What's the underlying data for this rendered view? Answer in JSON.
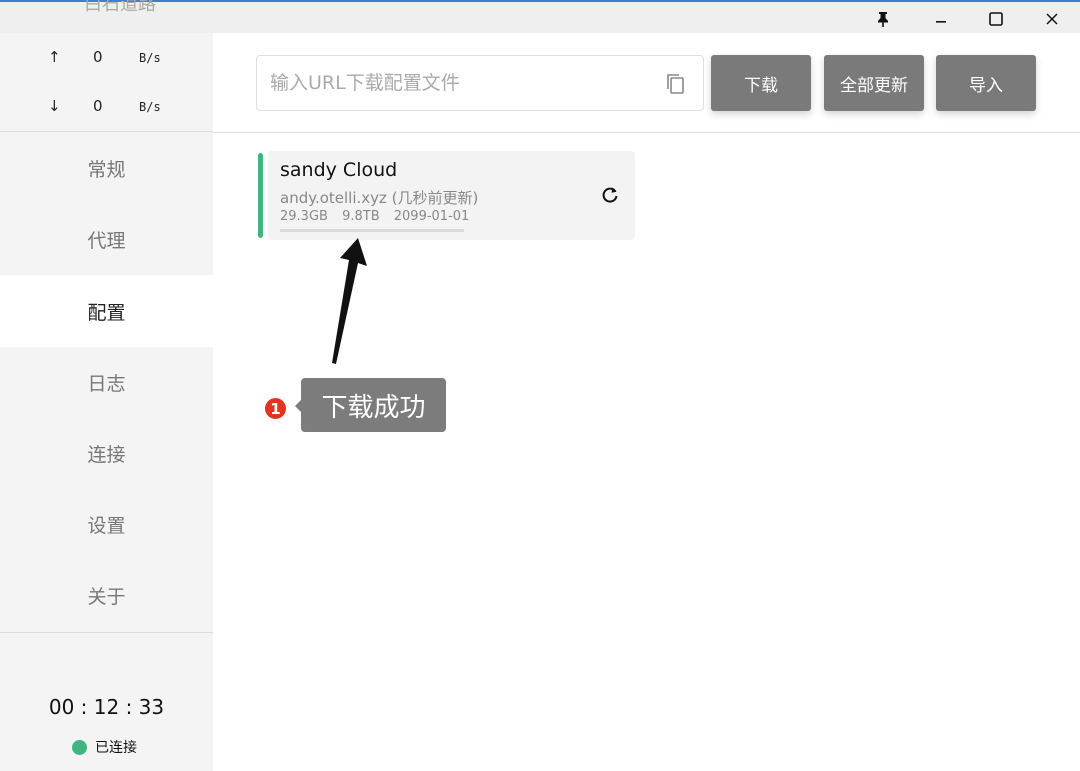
{
  "titlebar": {
    "ghost_text": "白石道路",
    "pin_icon": "pin-icon",
    "minimize_icon": "minimize-icon",
    "maximize_icon": "maximize-icon",
    "close_icon": "close-icon"
  },
  "traffic": {
    "up": {
      "arrow": "↑",
      "value": "0",
      "unit": "B/s"
    },
    "down": {
      "arrow": "↓",
      "value": "0",
      "unit": "B/s"
    }
  },
  "nav": {
    "items": [
      {
        "label": "常规"
      },
      {
        "label": "代理"
      },
      {
        "label": "配置"
      },
      {
        "label": "日志"
      },
      {
        "label": "连接"
      },
      {
        "label": "设置"
      },
      {
        "label": "关于"
      }
    ],
    "active": "配置"
  },
  "footer": {
    "timer": "00 : 12 : 33",
    "status": "已连接",
    "status_color": "#3fb57f"
  },
  "toolbar": {
    "url_placeholder": "输入URL下载配置文件",
    "url_value": "",
    "download_label": "下载",
    "update_all_label": "全部更新",
    "import_label": "导入"
  },
  "profile": {
    "name": "sandy Cloud",
    "host": "andy.otelli.xyz (几秒前更新)",
    "used": "29.3GB",
    "total": "9.8TB",
    "expire": "2099-01-01",
    "accent_color": "#3fb57f"
  },
  "annotation": {
    "step": "1",
    "text": "下载成功"
  }
}
